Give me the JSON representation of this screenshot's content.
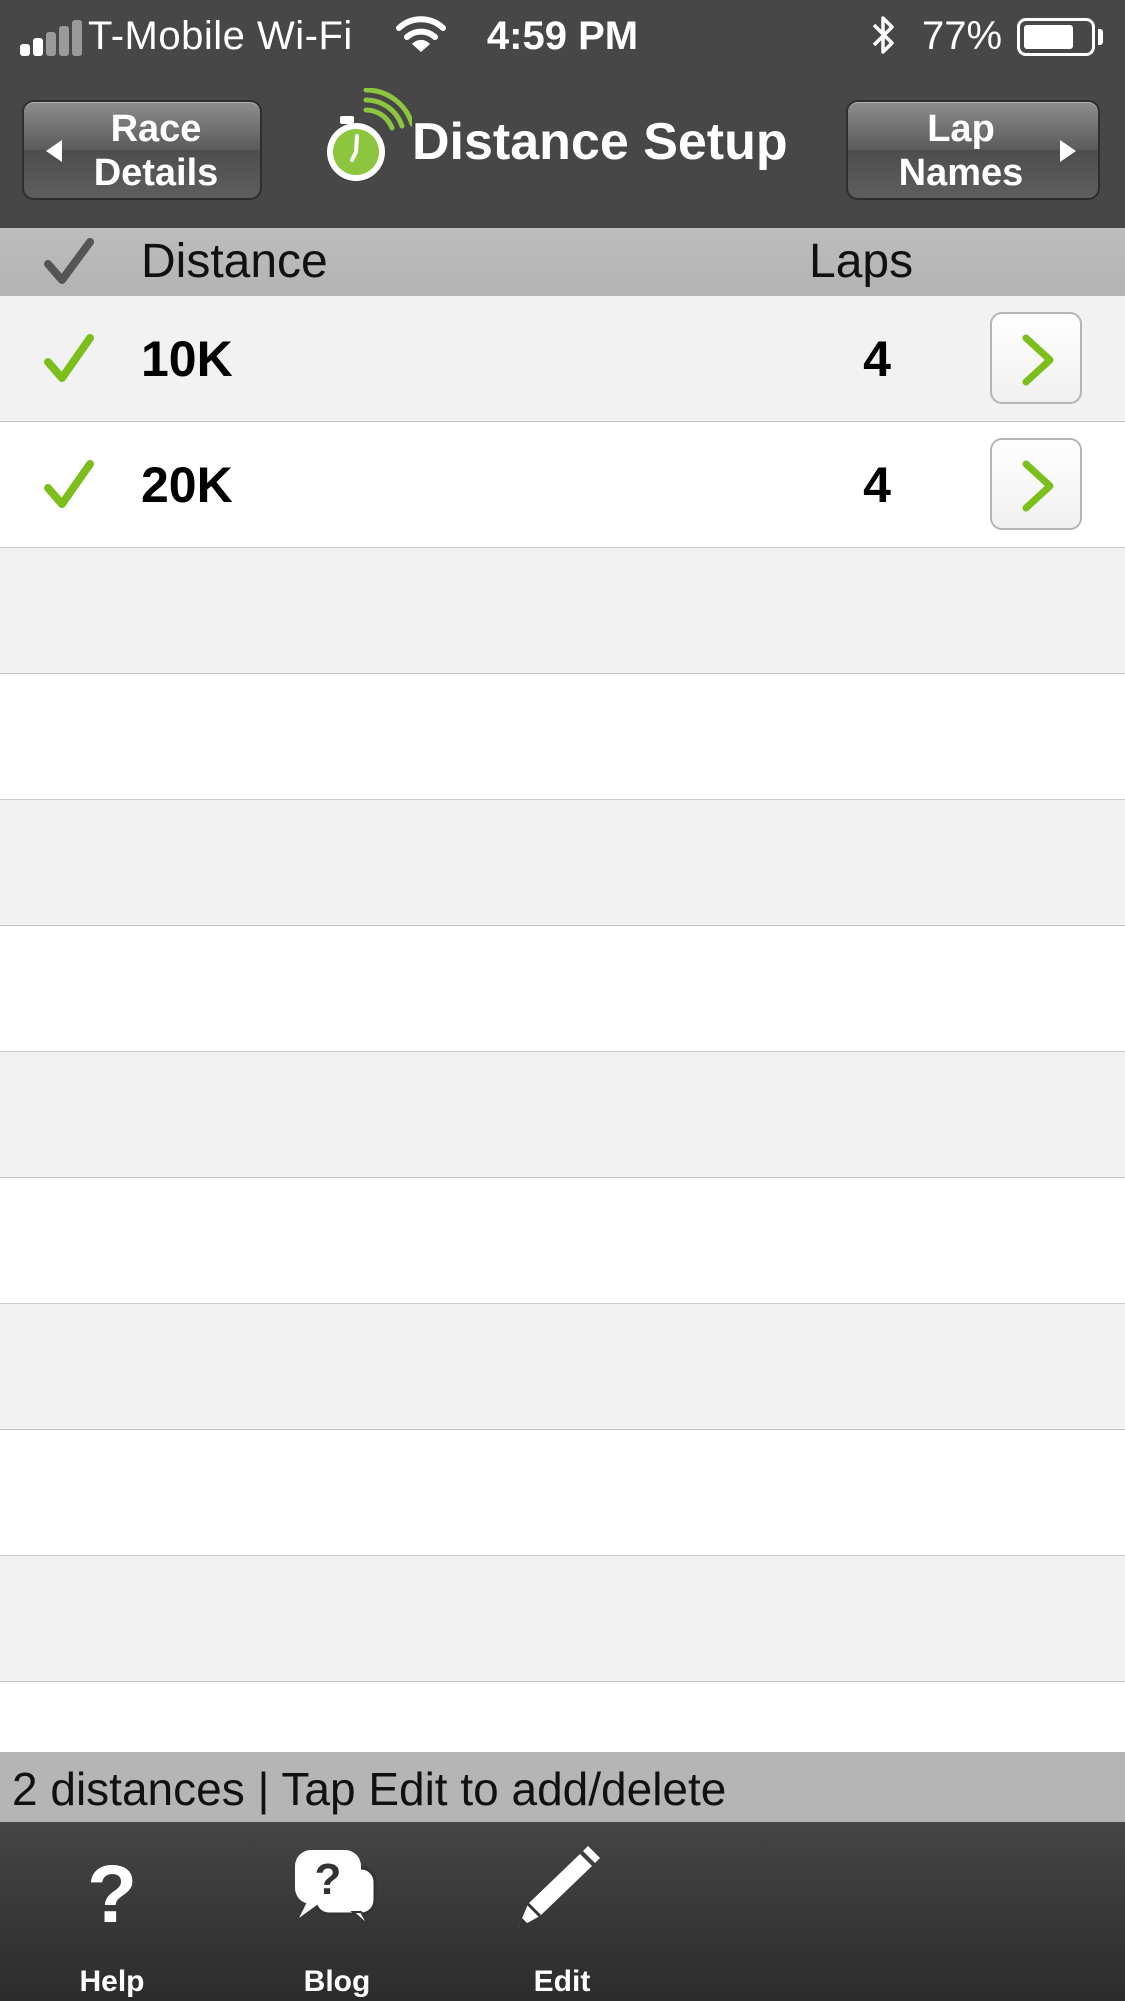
{
  "status_bar": {
    "carrier": "T-Mobile Wi-Fi",
    "time": "4:59 PM",
    "battery_percent": "77%",
    "battery_level": 0.77,
    "signal_bars": 2
  },
  "nav": {
    "back_label_line1": "Race",
    "back_label_line2": "Details",
    "title": "Distance Setup",
    "forward_label_line1": "Lap",
    "forward_label_line2": "Names"
  },
  "columns": {
    "distance": "Distance",
    "laps": "Laps"
  },
  "rows": [
    {
      "name": "10K",
      "laps": "4",
      "checked": true
    },
    {
      "name": "20K",
      "laps": "4",
      "checked": true
    }
  ],
  "footer": {
    "status": "2 distances | Tap Edit to add/delete"
  },
  "tabs": {
    "help": "Help",
    "blog": "Blog",
    "edit": "Edit"
  },
  "colors": {
    "accent_green": "#7cbf1c",
    "bar_dark": "#474747",
    "header_gray": "#b8b8b8"
  }
}
